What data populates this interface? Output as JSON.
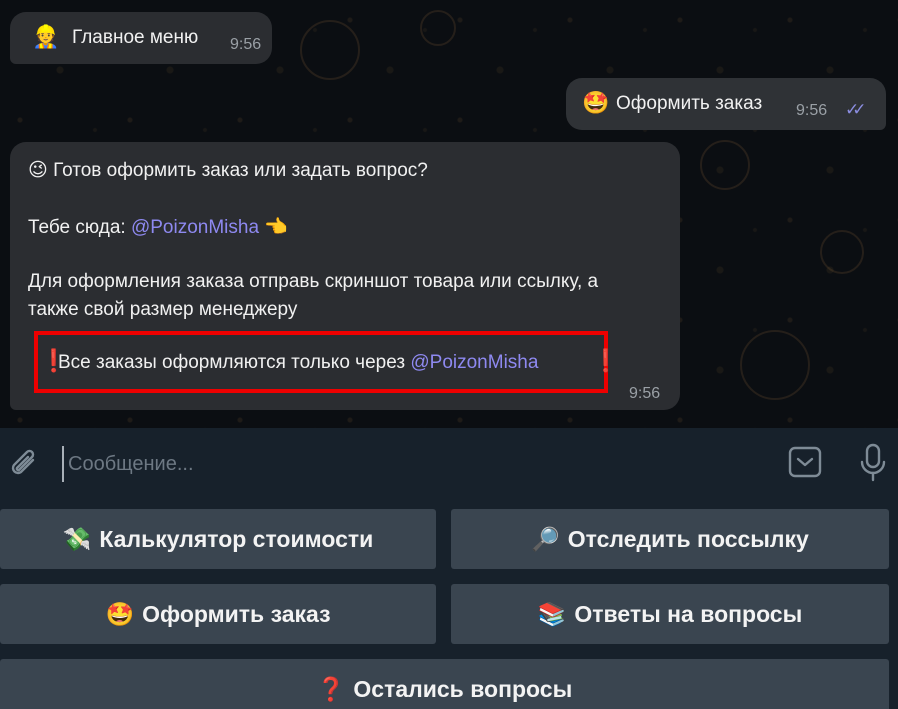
{
  "messages": [
    {
      "emoji": "👷",
      "text": "Главное меню",
      "time": "9:56",
      "direction": "incoming"
    },
    {
      "emoji": "🤩",
      "text": "Оформить заказ",
      "time": "9:56",
      "direction": "outgoing",
      "status": "read"
    },
    {
      "direction": "incoming",
      "time": "9:56",
      "line1": "😉 Готов оформить заказ или задать вопрос?",
      "line2_prefix": "Тебе сюда: ",
      "line2_mention": "@PoizonMisha",
      "line2_suffix": " 👈",
      "line3": "Для оформления заказа отправь скриншот товара или ссылку, а",
      "line4": "также свой размер менеджеру",
      "warning_mark": "❗",
      "warning_text": "Все заказы оформляются только через ",
      "warning_mention": "@PoizonMisha"
    }
  ],
  "composer": {
    "placeholder": "Сообщение..."
  },
  "keyboard": {
    "rows": [
      [
        {
          "emoji": "💸",
          "label": "Калькулятор стоимости"
        },
        {
          "emoji": "🔎",
          "label": "Отследить поссылку"
        }
      ],
      [
        {
          "emoji": "🤩",
          "label": "Оформить заказ"
        },
        {
          "emoji": "📚",
          "label": "Ответы на вопросы"
        }
      ],
      [
        {
          "emoji": "❓",
          "label": "Остались вопросы"
        }
      ]
    ]
  },
  "colors": {
    "mention": "#8e89f0",
    "highlight_border": "#ee0000",
    "bubble": "#2b2d31",
    "read_ticks": "#8b8de0"
  }
}
